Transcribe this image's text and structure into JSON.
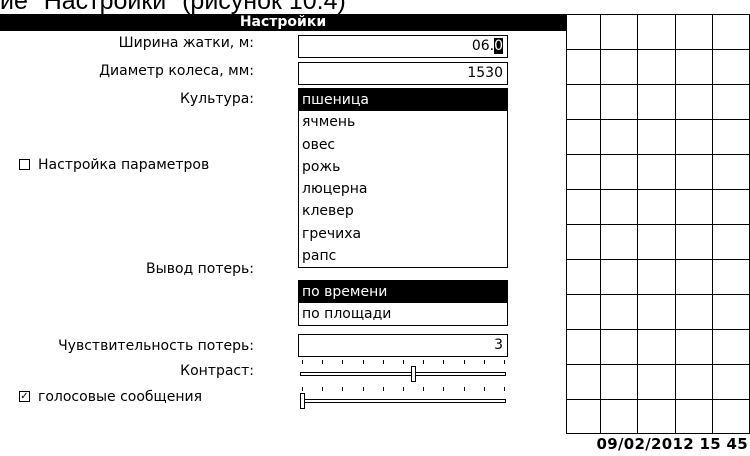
{
  "caption_fragment": "ие \"Настройки\" (рисунок 10.4)",
  "title": "Настройки",
  "fields": {
    "header_width": {
      "label": "Ширина жатки, м:",
      "value_main": "06.",
      "value_cursor": "0"
    },
    "wheel_diameter": {
      "label": "Диаметр колеса, мм:",
      "value": "1530"
    },
    "crop": {
      "label": "Культура:",
      "options": [
        "пшеница",
        "ячмень",
        "овес",
        "рожь",
        "люцерна",
        "клевер",
        "гречиха",
        "рапс"
      ],
      "selected_index": 0
    },
    "params_setup": {
      "label": "Настройка параметров",
      "checked": false
    },
    "loss_output": {
      "label": "Вывод потерь:",
      "options": [
        "по времени",
        "по площади"
      ],
      "selected_index": 0
    },
    "loss_sensitivity": {
      "label": "Чувствительность потерь:",
      "value": "3"
    },
    "contrast": {
      "label": "Контраст:",
      "level": 0.55,
      "tick_count": 11
    },
    "voice_messages": {
      "label": "голосовые сообщения",
      "checked": true,
      "checkmark": "✓",
      "level": 0.0,
      "tick_count": 11
    }
  },
  "datetime": "09/02/2012 15 45"
}
